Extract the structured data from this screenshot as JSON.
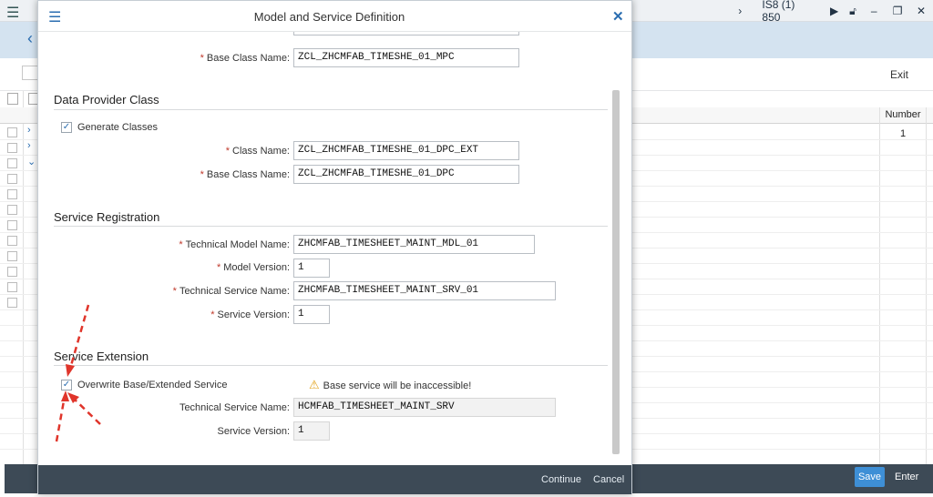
{
  "window": {
    "system_id": "IS8 (1) 850"
  },
  "toolbar": {
    "exit_label": "Exit"
  },
  "grid": {
    "number_header": "Number",
    "number_value": "1"
  },
  "footer": {
    "save_label": "Save",
    "enter_label": "Enter"
  },
  "dialog": {
    "title": "Model and Service Definition",
    "mpc": {
      "base_class_label": "Base Class Name:",
      "base_class_value": "ZCL_ZHCMFAB_TIMESHE_01_MPC"
    },
    "dpc": {
      "section_title": "Data Provider Class",
      "generate_label": "Generate Classes",
      "generate_checked": true,
      "class_label": "Class Name:",
      "class_value": "ZCL_ZHCMFAB_TIMESHE_01_DPC_EXT",
      "base_class_label": "Base Class Name:",
      "base_class_value": "ZCL_ZHCMFAB_TIMESHE_01_DPC"
    },
    "registration": {
      "section_title": "Service Registration",
      "tech_model_label": "Technical Model Name:",
      "tech_model_value": "ZHCMFAB_TIMESHEET_MAINT_MDL_01",
      "model_version_label": "Model Version:",
      "model_version_value": "1",
      "tech_service_label": "Technical Service Name:",
      "tech_service_value": "ZHCMFAB_TIMESHEET_MAINT_SRV_01",
      "service_version_label": "Service Version:",
      "service_version_value": "1"
    },
    "extension": {
      "section_title": "Service Extension",
      "overwrite_label": "Overwrite Base/Extended Service",
      "overwrite_checked": true,
      "warning_text": "Base service will be inaccessible!",
      "tech_service_label": "Technical Service Name:",
      "tech_service_value": "HCMFAB_TIMESHEET_MAINT_SRV",
      "service_version_label": "Service Version:",
      "service_version_value": "1"
    },
    "continue_label": "Continue",
    "cancel_label": "Cancel"
  },
  "colors": {
    "accent": "#2a6db0",
    "footer_bg": "#3d4a56",
    "save_bg": "#3e8fd6",
    "required": "#c0392b",
    "annotation_arrow": "#e0352b"
  }
}
